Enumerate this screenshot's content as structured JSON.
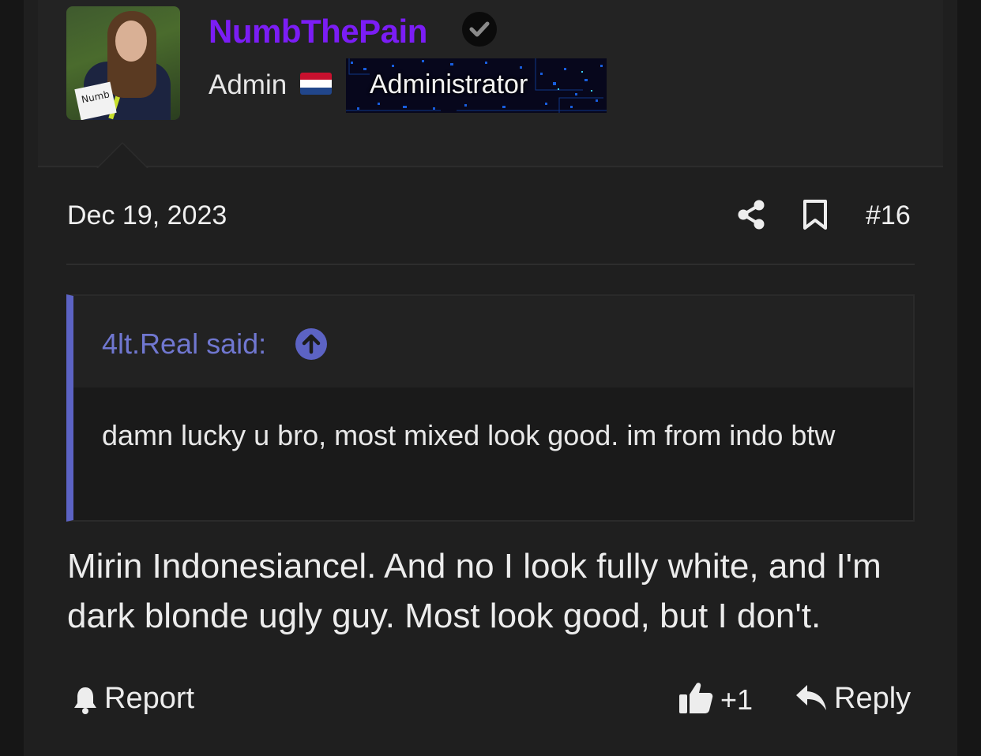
{
  "user": {
    "name": "NumbThePain",
    "role": "Admin",
    "banner": "Administrator",
    "avatar_sign": "Numb"
  },
  "post": {
    "date": "Dec 19, 2023",
    "number": "#16"
  },
  "quote": {
    "author": "4lt.Real said:",
    "text": "damn lucky u bro, most mixed look good. im from indo btw"
  },
  "message": "Mirin Indonesiancel. And no I look fully white, and I'm dark blonde ugly guy. Most look good, but I don't.",
  "actions": {
    "report": "Report",
    "reaction": "+1",
    "reply": "Reply"
  },
  "icons": [
    "verified-icon",
    "flag-netherlands-icon",
    "share-icon",
    "bookmark-icon",
    "arrow-up-icon",
    "bell-icon",
    "thumbs-up-icon",
    "reply-icon"
  ],
  "colors": {
    "username": "#7b1df5",
    "quote_accent": "#5c63c4",
    "background": "#1f1f1f"
  }
}
